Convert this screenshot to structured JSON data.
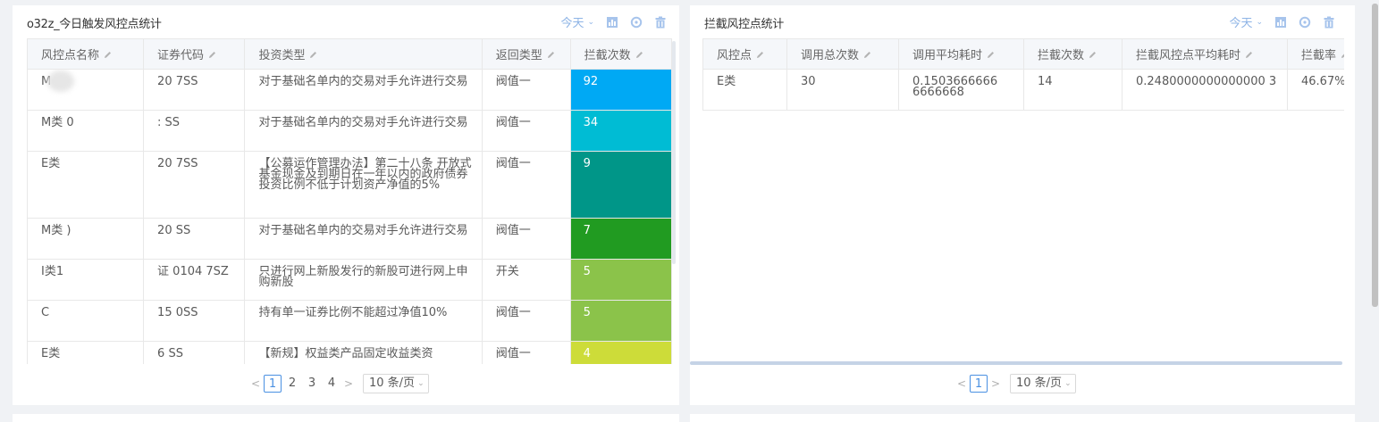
{
  "left": {
    "title": "o32z_今日触发风控点统计",
    "time_filter": "今天",
    "columns": [
      "风控点名称",
      "证券代码",
      "投资类型",
      "返回类型",
      "拦截次数"
    ],
    "rows": [
      {
        "name": "M",
        "code": "20 7SS",
        "type": "对于基础名单内的交易对手允许进行交易",
        "ret": "阀值一",
        "count": "92",
        "color": "#00a9f4"
      },
      {
        "name": "M类 0",
        "code": ": SS",
        "type": "对于基础名单内的交易对手允许进行交易",
        "ret": "阀值一",
        "count": "34",
        "color": "#00bcd4"
      },
      {
        "name": "E类",
        "code": "20 7SS",
        "type": "【公募运作管理办法】第二十八条 开放式基金现金及到期日在一年以内的政府债券投资比例不低于计划资产净值的5%",
        "ret": "阀值一",
        "count": "9",
        "color": "#009688"
      },
      {
        "name": "M类 )",
        "code": "20 SS",
        "type": "对于基础名单内的交易对手允许进行交易",
        "ret": "阀值一",
        "count": "7",
        "color": "#219b21"
      },
      {
        "name": "I类1",
        "code": "证 0104 7SZ",
        "type": "只进行网上新股发行的新股可进行网上申购新股",
        "ret": "开关",
        "count": "5",
        "color": "#8bc34a"
      },
      {
        "name": "C",
        "code": "15 0SS",
        "type": "持有单一证券比例不能超过净值10%",
        "ret": "阀值一",
        "count": "5",
        "color": "#8bc34a"
      },
      {
        "name": "E类",
        "code": "6 SS",
        "type": "【新规】权益类产品固定收益类资",
        "ret": "阀值一",
        "count": "4",
        "color": "#cddc39"
      }
    ],
    "pagination": {
      "prev": "<",
      "pages": [
        "1",
        "2",
        "3",
        "4"
      ],
      "next": ">",
      "page_size": "10 条/页"
    }
  },
  "right": {
    "title": "拦截风控点统计",
    "time_filter": "今天",
    "columns": [
      "风控点",
      "调用总次数",
      "调用平均耗时",
      "拦截次数",
      "拦截风控点平均耗时",
      "拦截率"
    ],
    "rows": [
      {
        "point": "E类",
        "total": "30",
        "avg": "0.1503666666 6666668",
        "intercepts": "14",
        "intercept_avg": "0.2480000000000000 3",
        "rate": "46.67%"
      }
    ],
    "pagination": {
      "prev": "<",
      "pages": [
        "1"
      ],
      "next": ">",
      "page_size": "10 条/页"
    }
  },
  "icons": {
    "chart": "bar-chart-icon",
    "settings": "settings-icon",
    "delete": "trash-icon",
    "edit": "pencil-icon",
    "dropdown": "chevron-down-icon"
  },
  "colors": {
    "accent": "#4a90e2",
    "filter_text": "#8eb4e6"
  }
}
